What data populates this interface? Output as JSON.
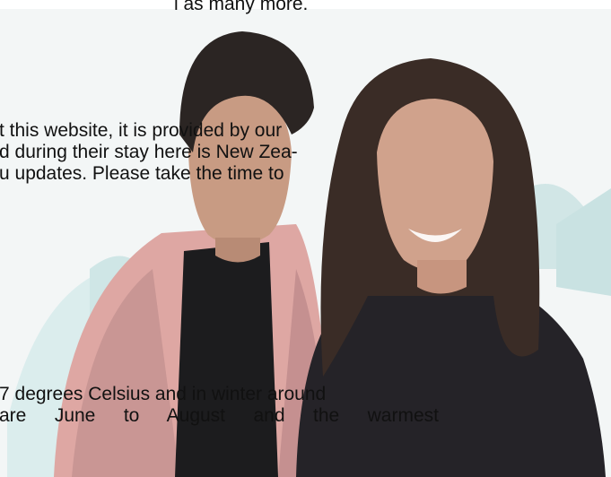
{
  "text": {
    "line_top": "l as many more.",
    "para1_line1": "t this website, it is provided by our",
    "para1_line2": "d during their stay here is New Zea-",
    "para1_line3": "u updates. Please take the time to",
    "para2_line1": "7 degrees Celsius and in winter around",
    "para2_line2": "are June to August and the warmest"
  },
  "colors": {
    "background": "#ffffff",
    "panel": "#f3f6f6",
    "teal_light": "#d6ebec",
    "teal_mid": "#b9dcdc",
    "text": "#111111"
  }
}
